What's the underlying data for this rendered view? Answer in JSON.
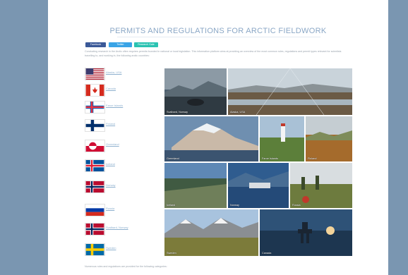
{
  "page": {
    "title": "PERMITS AND REGULATIONS FOR ARCTIC FIELDWORK",
    "share_buttons": [
      "Facebook",
      "Twitter",
      "Research Gate"
    ],
    "intro": "Conducting research in the Arctic often requires permits founded in national or local legislation. This information platform aims at providing an overview of the most common rules, regulations and permit types relevant for scientists travelling to, and working in, the following arctic countries:",
    "footnote": "Numerous rules and regulations are provided for the following categories:"
  },
  "flags": [
    {
      "label": "Alaska, USA",
      "flag_icon": "usa-flag-icon"
    },
    {
      "label": "Canada",
      "flag_icon": "canada-flag-icon"
    },
    {
      "label": "Faroe Islands",
      "flag_icon": "faroe-islands-flag-icon"
    },
    {
      "label": "Finland",
      "flag_icon": "finland-flag-icon"
    },
    {
      "label": "Greenland",
      "flag_icon": "greenland-flag-icon"
    },
    {
      "label": "Iceland",
      "flag_icon": "iceland-flag-icon"
    },
    {
      "label": "Norway",
      "flag_icon": "norway-flag-icon"
    },
    {
      "label": "Russia",
      "flag_icon": "russia-flag-icon"
    },
    {
      "label": "Svalbard, Norway",
      "flag_icon": "norway-flag-icon"
    },
    {
      "label": "Sweden",
      "flag_icon": "sweden-flag-icon"
    }
  ],
  "photos": [
    {
      "label": "Svalbard, Norway"
    },
    {
      "label": "Alaska, USA"
    },
    {
      "label": "Greenland"
    },
    {
      "label": "Faroe Islands"
    },
    {
      "label": "Finland"
    },
    {
      "label": "Iceland"
    },
    {
      "label": "Norway"
    },
    {
      "label": "Russia"
    },
    {
      "label": "Sweden"
    },
    {
      "label": "Canada"
    }
  ],
  "colors": {
    "side_bars": "#7a96b1",
    "title": "#8aa7c6",
    "link": "#8fb1cf"
  }
}
